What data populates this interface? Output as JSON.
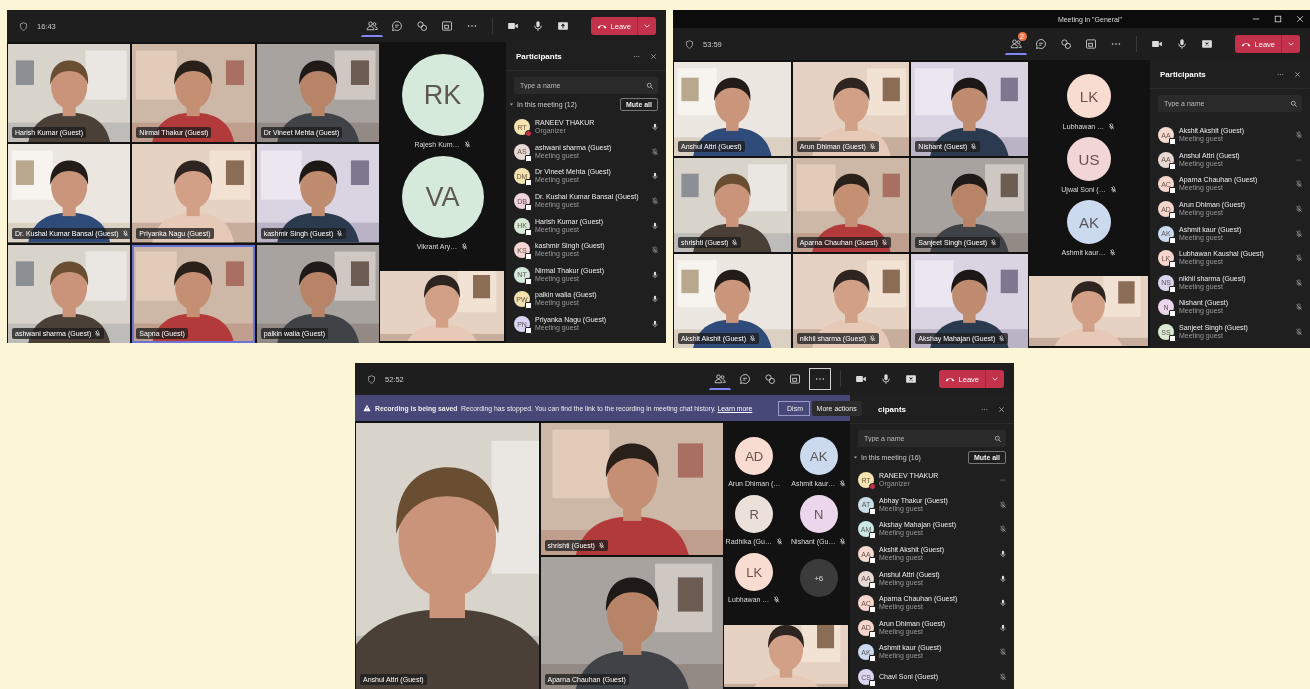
{
  "windows": [
    {
      "kind": "grid",
      "timer": "16:43",
      "toolbar": [
        {
          "kind": "people",
          "selected": true
        },
        {
          "kind": "chat",
          "selected": false
        },
        {
          "kind": "reaction",
          "selected": false
        },
        {
          "kind": "rooms",
          "selected": false
        },
        {
          "kind": "more",
          "selected": false
        },
        {
          "kind": "camera",
          "selected": false
        },
        {
          "kind": "mic",
          "selected": false
        },
        {
          "kind": "share",
          "selected": false
        }
      ],
      "leave": "Leave",
      "tiles": [
        {
          "name": "Harish Kumar (Guest)",
          "muted": false,
          "speaking": false
        },
        {
          "name": "Nirmal Thakur (Guest)",
          "muted": false,
          "speaking": false
        },
        {
          "name": "Dr Vineet Mehta (Guest)",
          "muted": false,
          "speaking": false
        },
        {
          "name": "Dr. Kushal Kumar Bansal (Guest)",
          "muted": true,
          "speaking": false
        },
        {
          "name": "Priyanka Nagu (Guest)",
          "muted": false,
          "speaking": false
        },
        {
          "name": "kashmir Singh (Guest)",
          "muted": true,
          "speaking": false
        },
        {
          "name": "ashwani sharma (Guest)",
          "muted": true,
          "speaking": false
        },
        {
          "name": "Sapna (Guest)",
          "muted": false,
          "speaking": true
        },
        {
          "name": "palkin walia (Guest)",
          "muted": false,
          "speaking": false
        }
      ],
      "avatars": [
        {
          "kind": "person",
          "initials": "RK",
          "name": "Rajesh Kum…",
          "muted": true,
          "color": "#d6eadc"
        },
        {
          "kind": "person",
          "initials": "VA",
          "name": "Vikrant Ary…",
          "muted": true,
          "color": "#d6eadc"
        }
      ],
      "panel": {
        "title": "Participants",
        "search": {
          "placeholder": "Type a name"
        },
        "section": {
          "label": "In this meeting (12)",
          "expanded": true,
          "button": "Mute all"
        },
        "rows": [
          {
            "initials": "RT",
            "color": "#f6e4b0",
            "name": "RANEEV THAKUR",
            "role": "Organizer",
            "busy": true,
            "muted": false,
            "hovered": false
          },
          {
            "initials": "AS",
            "color": "#e7d8d4",
            "name": "ashwani sharma (Guest)",
            "role": "Meeting guest",
            "busy": false,
            "muted": true,
            "hovered": false
          },
          {
            "initials": "DM",
            "color": "#f4e2b0",
            "name": "Dr Vineet Mehta (Guest)",
            "role": "Meeting guest",
            "busy": false,
            "muted": false,
            "hovered": false
          },
          {
            "initials": "DB",
            "color": "#f1d2df",
            "name": "Dr. Kushal Kumar Bansal (Guest)",
            "role": "Meeting guest",
            "busy": false,
            "muted": true,
            "hovered": false
          },
          {
            "initials": "HK",
            "color": "#d8e9d6",
            "name": "Harish Kumar (Guest)",
            "role": "Meeting guest",
            "busy": false,
            "muted": false,
            "hovered": false
          },
          {
            "initials": "KS",
            "color": "#f5d5d4",
            "name": "kashmir Singh (Guest)",
            "role": "Meeting guest",
            "busy": false,
            "muted": true,
            "hovered": false
          },
          {
            "initials": "NT",
            "color": "#d5e9dc",
            "name": "Nirmal Thakur (Guest)",
            "role": "Meeting guest",
            "busy": false,
            "muted": false,
            "hovered": false
          },
          {
            "initials": "PW",
            "color": "#f4e2b0",
            "name": "palkin walia (Guest)",
            "role": "Meeting guest",
            "busy": false,
            "muted": false,
            "hovered": false
          },
          {
            "initials": "PN",
            "color": "#dbd4f0",
            "name": "Priyanka Nagu (Guest)",
            "role": "Meeting guest",
            "busy": false,
            "muted": false,
            "hovered": false
          }
        ]
      }
    },
    {
      "kind": "grid",
      "title": "Meeting in \"General\"",
      "timer": "53:59",
      "toolbar": [
        {
          "kind": "people",
          "selected": true,
          "badge": "2"
        },
        {
          "kind": "chat",
          "selected": false
        },
        {
          "kind": "reaction",
          "selected": false
        },
        {
          "kind": "rooms",
          "selected": false
        },
        {
          "kind": "more",
          "selected": false
        },
        {
          "kind": "camera",
          "selected": false
        },
        {
          "kind": "mic",
          "selected": false
        },
        {
          "kind": "stop-share",
          "selected": false
        }
      ],
      "leave": "Leave",
      "tiles": [
        {
          "name": "Anshul Attri (Guest)",
          "muted": false,
          "speaking": false
        },
        {
          "name": "Arun Dhiman (Guest)",
          "muted": true,
          "speaking": false
        },
        {
          "name": "Nishant (Guest)",
          "muted": true,
          "speaking": false
        },
        {
          "name": "shrishti (Guest)",
          "muted": true,
          "speaking": false
        },
        {
          "name": "Aparna Chauhan (Guest)",
          "muted": true,
          "speaking": false
        },
        {
          "name": "Sanjeet Singh (Guest)",
          "muted": true,
          "speaking": false
        },
        {
          "name": "Akshit Akshit (Guest)",
          "muted": true,
          "speaking": false
        },
        {
          "name": "nikhil sharma (Guest)",
          "muted": true,
          "speaking": false
        },
        {
          "name": "Akshay Mahajan (Guest)",
          "muted": true,
          "speaking": false
        }
      ],
      "avatars": [
        {
          "kind": "person",
          "initials": "LK",
          "name": "Lubhawan …",
          "muted": true,
          "color": "#f8dcd2"
        },
        {
          "kind": "person",
          "initials": "US",
          "name": "Ujwal Soni (…",
          "muted": true,
          "color": "#f2d6d6"
        },
        {
          "kind": "person",
          "initials": "AK",
          "name": "Ashmit kaur…",
          "muted": true,
          "color": "#cbdaef"
        }
      ],
      "panel": {
        "title": "Participants",
        "search": {
          "placeholder": "Type a name"
        },
        "rows": [
          {
            "initials": "AA",
            "color": "#f6dad0",
            "name": "Akshit Akshit (Guest)",
            "role": "Meeting guest",
            "busy": false,
            "muted": true,
            "hovered": false
          },
          {
            "initials": "AA",
            "color": "#e9d9d4",
            "name": "Anshul Attri (Guest)",
            "role": "Meeting guest",
            "busy": false,
            "hovered": true
          },
          {
            "initials": "AC",
            "color": "#f6d6cc",
            "name": "Aparna Chauhan (Guest)",
            "role": "Meeting guest",
            "busy": false,
            "muted": true,
            "hovered": false
          },
          {
            "initials": "AD",
            "color": "#f6d6cc",
            "name": "Arun Dhiman (Guest)",
            "role": "Meeting guest",
            "busy": false,
            "muted": true,
            "hovered": false
          },
          {
            "initials": "AK",
            "color": "#cbdaef",
            "name": "Ashmit kaur (Guest)",
            "role": "Meeting guest",
            "busy": false,
            "muted": true,
            "hovered": false
          },
          {
            "initials": "LK",
            "color": "#f6d6cc",
            "name": "Lubhawan Kaushal (Guest)",
            "role": "Meeting guest",
            "busy": false,
            "muted": true,
            "hovered": false
          },
          {
            "initials": "NS",
            "color": "#dcd5f0",
            "name": "nikhil sharma (Guest)",
            "role": "Meeting guest",
            "busy": false,
            "muted": true,
            "hovered": false
          },
          {
            "initials": "N",
            "color": "#ecd6ec",
            "name": "Nishant (Guest)",
            "role": "Meeting guest",
            "busy": false,
            "muted": true,
            "hovered": false
          },
          {
            "initials": "SS",
            "color": "#dbead3",
            "name": "Sanjeet Singh (Guest)",
            "role": "Meeting guest",
            "busy": false,
            "muted": true,
            "hovered": false
          }
        ]
      }
    },
    {
      "kind": "focus",
      "timer": "52:52",
      "toolbar": [
        {
          "kind": "people",
          "selected": true
        },
        {
          "kind": "chat",
          "selected": false
        },
        {
          "kind": "reaction",
          "selected": false
        },
        {
          "kind": "rooms",
          "selected": false
        },
        {
          "kind": "more",
          "selected": true,
          "tooltip": "More actions"
        },
        {
          "kind": "camera",
          "selected": false
        },
        {
          "kind": "mic",
          "selected": false
        },
        {
          "kind": "stop-share",
          "selected": false
        }
      ],
      "leave": "Leave",
      "banner": {
        "title": "Recording is being saved",
        "text": "Recording has stopped. You can find the link to the recording in meeting chat history.",
        "link": "Learn more",
        "button": "Dism"
      },
      "tiles": [
        {
          "name": "Anshul Attri (Guest)",
          "muted": false,
          "speaking": false
        },
        {
          "name": "shrishti (Guest)",
          "muted": true,
          "speaking": false
        },
        {
          "name": "Aparna Chauhan (Guest)",
          "muted": false,
          "speaking": false
        }
      ],
      "avatars": [
        {
          "kind": "person",
          "initials": "AD",
          "name": "Arun Dhiman (…",
          "muted": false,
          "color": "#f8dcd2"
        },
        {
          "kind": "person",
          "initials": "AK",
          "name": "Ashmit kaur…",
          "muted": true,
          "color": "#cbdaef"
        },
        {
          "kind": "person",
          "initials": "R",
          "name": "Radhika (Gu…",
          "muted": true,
          "color": "#ece0da"
        },
        {
          "kind": "person",
          "initials": "N",
          "name": "Nishant (Gu…",
          "muted": true,
          "color": "#ecd6ec"
        },
        {
          "kind": "person",
          "initials": "LK",
          "name": "Lubhawan …",
          "muted": true,
          "color": "#f8dcd2"
        },
        {
          "kind": "overflow",
          "initials": "+6"
        }
      ],
      "panel": {
        "title": "cipants",
        "search": {
          "placeholder": "Type a name"
        },
        "section": {
          "label": "In this meeting (16)",
          "expanded": true,
          "button": "Mute all"
        },
        "rows": [
          {
            "initials": "RT",
            "color": "#f6e4b0",
            "name": "RANEEV THAKUR",
            "role": "Organizer",
            "busy": true,
            "hovered": true
          },
          {
            "initials": "AT",
            "color": "#c9dde6",
            "name": "Abhay Thakur (Guest)",
            "role": "Meeting guest",
            "busy": false,
            "muted": true,
            "hovered": false
          },
          {
            "initials": "AM",
            "color": "#c9e8e6",
            "name": "Akshay Mahajan (Guest)",
            "role": "Meeting guest",
            "busy": false,
            "muted": true,
            "hovered": false
          },
          {
            "initials": "AA",
            "color": "#f6dad0",
            "name": "Akshit Akshit (Guest)",
            "role": "Meeting guest",
            "busy": false,
            "muted": false,
            "hovered": false
          },
          {
            "initials": "AA",
            "color": "#e9d9d4",
            "name": "Anshul Attri (Guest)",
            "role": "Meeting guest",
            "busy": false,
            "muted": false,
            "hovered": false
          },
          {
            "initials": "AC",
            "color": "#f6d6cc",
            "name": "Aparna Chauhan (Guest)",
            "role": "Meeting guest",
            "busy": false,
            "muted": false,
            "hovered": false
          },
          {
            "initials": "AD",
            "color": "#f6d6cc",
            "name": "Arun Dhiman (Guest)",
            "role": "Meeting guest",
            "busy": false,
            "muted": false,
            "hovered": false
          },
          {
            "initials": "AK",
            "color": "#cbdaef",
            "name": "Ashmit kaur (Guest)",
            "role": "Meeting guest",
            "busy": false,
            "muted": true,
            "hovered": false
          },
          {
            "initials": "CS",
            "color": "#dcd5f0",
            "name": "Chavi Soni (Guest)",
            "busy": false,
            "muted": true,
            "hovered": false
          }
        ]
      }
    }
  ]
}
